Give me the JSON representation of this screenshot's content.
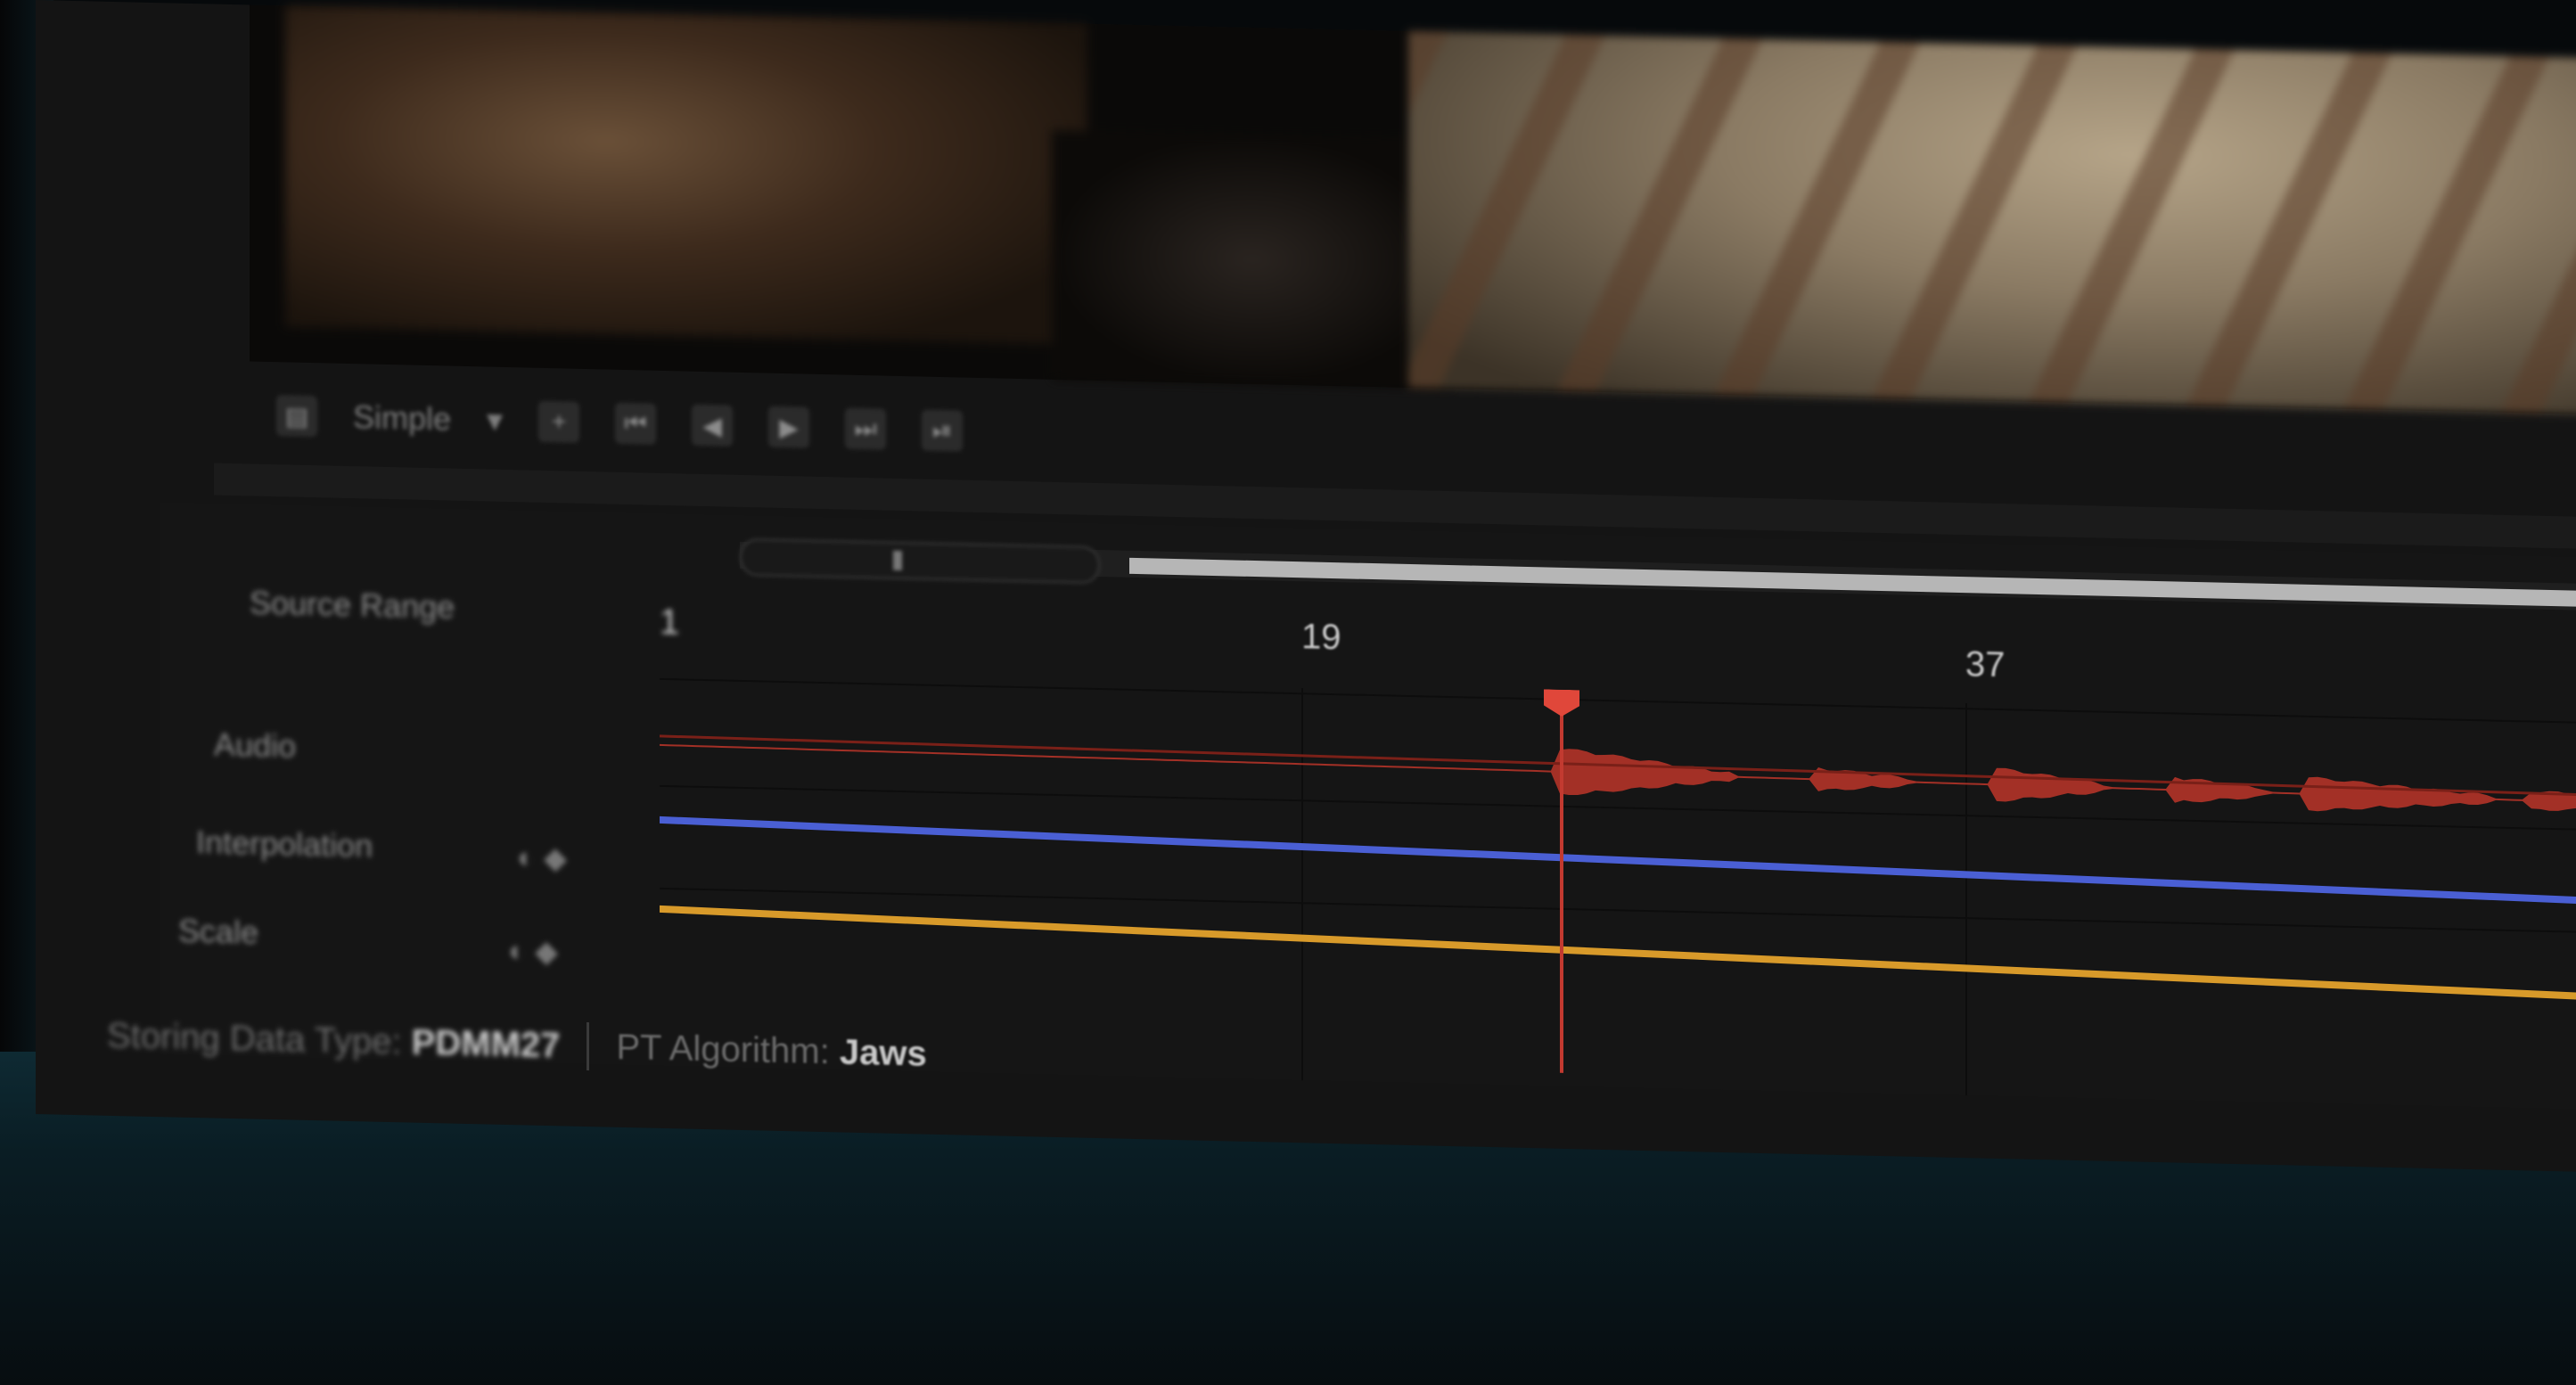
{
  "toolbar": {
    "dropdown_label": "Simple",
    "tools": [
      "add-keyframe-icon",
      "go-to-start-icon",
      "step-back-icon",
      "play-icon",
      "step-forward-icon",
      "go-to-end-icon"
    ]
  },
  "timeline": {
    "tracks": [
      {
        "label": "Source Range"
      },
      {
        "label": "Audio"
      },
      {
        "label": "Interpolation"
      },
      {
        "label": "Scale"
      }
    ],
    "ruler_labels": [
      "1",
      "19",
      "37"
    ],
    "range_fill_percent": 90,
    "playhead_frame": 24
  },
  "status": {
    "storing_key": "Storing Data Type:",
    "storing_value": "PDMM27",
    "algo_key": "PT Algorithm:",
    "algo_value": "Jaws"
  },
  "colors": {
    "audio": "#b33328",
    "interpolation": "#4a5fd4",
    "scale": "#d89a2a",
    "playhead": "#e0473a"
  }
}
